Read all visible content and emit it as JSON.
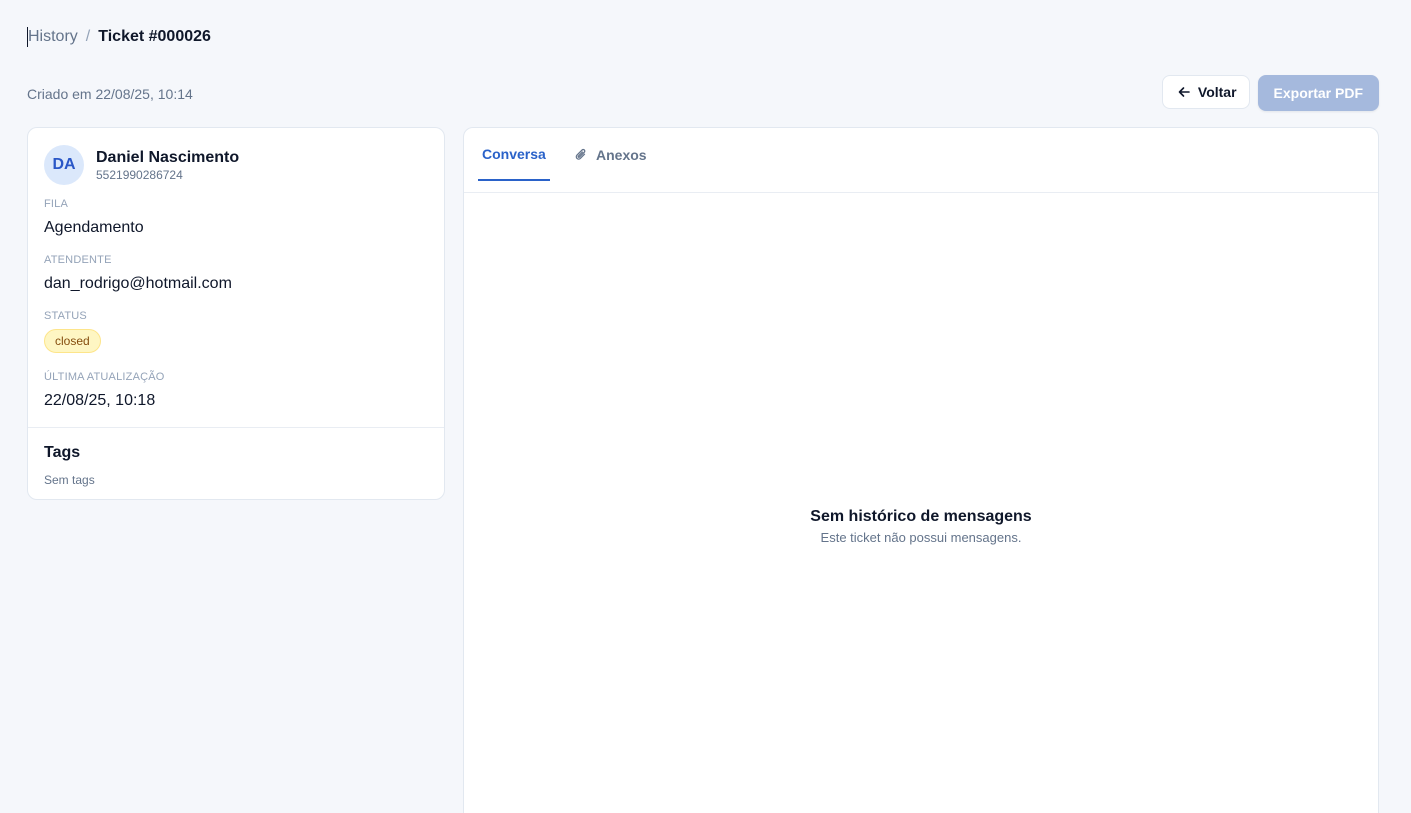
{
  "breadcrumb": {
    "parent": "History",
    "separator": "/",
    "current": "Ticket #000026"
  },
  "header": {
    "created": "Criado em 22/08/25, 10:14",
    "back_label": "Voltar",
    "export_label": "Exportar PDF"
  },
  "contact": {
    "initials": "DA",
    "name": "Daniel Nascimento",
    "phone": "5521990286724"
  },
  "details": {
    "queue_label": "FILA",
    "queue_value": "Agendamento",
    "agent_label": "ATENDENTE",
    "agent_value": "dan_rodrigo@hotmail.com",
    "status_label": "STATUS",
    "status_value": "closed",
    "updated_label": "ÚLTIMA ATUALIZAÇÃO",
    "updated_value": "22/08/25, 10:18"
  },
  "tags": {
    "title": "Tags",
    "empty": "Sem tags"
  },
  "tabs": [
    {
      "label": "Conversa",
      "active": true
    },
    {
      "label": "Anexos",
      "active": false,
      "icon": "paperclip-icon"
    }
  ],
  "empty_state": {
    "title": "Sem histórico de mensagens",
    "subtitle": "Este ticket não possui mensagens."
  },
  "colors": {
    "accent": "#2a62c9",
    "background": "#f5f7fb",
    "export_disabled": "#a5b9dd",
    "badge_bg": "#fef6c3",
    "badge_text": "#854d0e"
  }
}
